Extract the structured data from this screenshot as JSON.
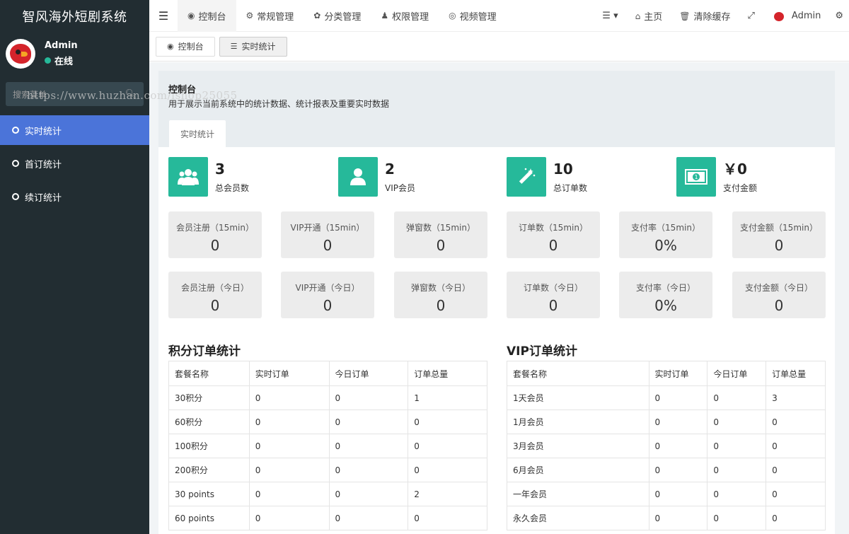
{
  "brand": "智风海外短剧系统",
  "user": {
    "name": "Admin",
    "status": "在线"
  },
  "search": {
    "placeholder": "搜索菜单"
  },
  "watermark": "https://www.huzhan.com/ishop25055",
  "sidebar": {
    "items": [
      {
        "label": "实时统计",
        "active": true
      },
      {
        "label": "首订统计",
        "active": false
      },
      {
        "label": "续订统计",
        "active": false
      }
    ]
  },
  "topnav": {
    "items": [
      {
        "label": "控制台",
        "icon": "dashboard-icon"
      },
      {
        "label": "常规管理",
        "icon": "cogs-icon"
      },
      {
        "label": "分类管理",
        "icon": "leaf-icon"
      },
      {
        "label": "权限管理",
        "icon": "users-icon"
      },
      {
        "label": "视频管理",
        "icon": "chrome-icon"
      }
    ],
    "home": "主页",
    "clear_cache": "清除缓存",
    "admin": "Admin"
  },
  "tabs": [
    {
      "label": "控制台",
      "icon": "dashboard-icon"
    },
    {
      "label": "实时统计",
      "icon": "list-icon"
    }
  ],
  "panel": {
    "title": "控制台",
    "desc": "用于展示当前系统中的统计数据、统计报表及重要实时数据",
    "tab": "实时统计"
  },
  "stats": [
    {
      "value": "3",
      "label": "总会员数",
      "icon": "users-icon"
    },
    {
      "value": "2",
      "label": "VIP会员",
      "icon": "user-icon"
    },
    {
      "value": "10",
      "label": "总订单数",
      "icon": "magic-icon"
    },
    {
      "value": "￥0",
      "label": "支付金额",
      "icon": "money-icon"
    }
  ],
  "metrics_15min": [
    {
      "label": "会员注册（15min）",
      "value": "0"
    },
    {
      "label": "VIP开通（15min）",
      "value": "0"
    },
    {
      "label": "弹窗数（15min）",
      "value": "0"
    },
    {
      "label": "订单数（15min）",
      "value": "0"
    },
    {
      "label": "支付率（15min）",
      "value": "0%"
    },
    {
      "label": "支付金额（15min）",
      "value": "0"
    }
  ],
  "metrics_today": [
    {
      "label": "会员注册（今日）",
      "value": "0"
    },
    {
      "label": "VIP开通（今日）",
      "value": "0"
    },
    {
      "label": "弹窗数（今日）",
      "value": "0"
    },
    {
      "label": "订单数（今日）",
      "value": "0"
    },
    {
      "label": "支付率（今日）",
      "value": "0%"
    },
    {
      "label": "支付金额（今日）",
      "value": "0"
    }
  ],
  "points_table": {
    "title": "积分订单统计",
    "headers": [
      "套餐名称",
      "实时订单",
      "今日订单",
      "订单总量"
    ],
    "rows": [
      [
        "30积分",
        "0",
        "0",
        "1"
      ],
      [
        "60积分",
        "0",
        "0",
        "0"
      ],
      [
        "100积分",
        "0",
        "0",
        "0"
      ],
      [
        "200积分",
        "0",
        "0",
        "0"
      ],
      [
        "30 points",
        "0",
        "0",
        "2"
      ],
      [
        "60 points",
        "0",
        "0",
        "0"
      ]
    ]
  },
  "vip_table": {
    "title": "VIP订单统计",
    "headers": [
      "套餐名称",
      "实时订单",
      "今日订单",
      "订单总量"
    ],
    "rows": [
      [
        "1天会员",
        "0",
        "0",
        "3"
      ],
      [
        "1月会员",
        "0",
        "0",
        "0"
      ],
      [
        "3月会员",
        "0",
        "0",
        "0"
      ],
      [
        "6月会员",
        "0",
        "0",
        "0"
      ],
      [
        "一年会员",
        "0",
        "0",
        "0"
      ],
      [
        "永久会员",
        "0",
        "0",
        "0"
      ]
    ]
  },
  "colors": {
    "sidebar": "#222d32",
    "active_menu": "#4b74d9",
    "accent": "#26b99a"
  }
}
